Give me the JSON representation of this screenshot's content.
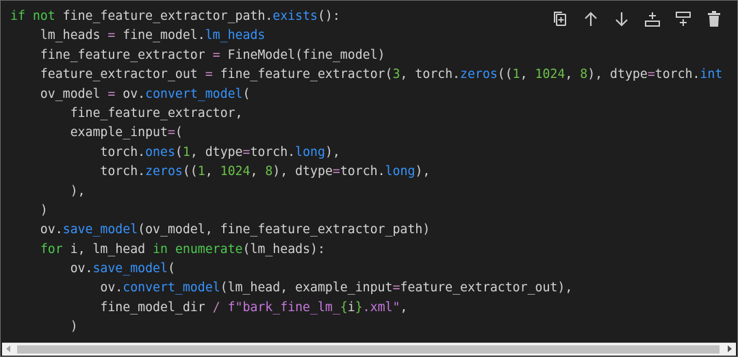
{
  "toolbar": {
    "icons": [
      "copy-icon",
      "arrow-up-icon",
      "arrow-down-icon",
      "insert-above-icon",
      "insert-below-icon",
      "trash-icon"
    ]
  },
  "code": {
    "language": "python",
    "lines": [
      [
        [
          "kw",
          "if"
        ],
        [
          "p",
          " "
        ],
        [
          "kw",
          "not"
        ],
        [
          "p",
          " fine_feature_extractor_path."
        ],
        [
          "fn",
          "exists"
        ],
        [
          "p",
          "():"
        ]
      ],
      [
        [
          "p",
          "    lm_heads "
        ],
        [
          "op",
          "="
        ],
        [
          "p",
          " fine_model."
        ],
        [
          "fn",
          "lm_heads"
        ]
      ],
      [
        [
          "p",
          "    fine_feature_extractor "
        ],
        [
          "op",
          "="
        ],
        [
          "p",
          " FineModel(fine_model)"
        ]
      ],
      [
        [
          "p",
          "    feature_extractor_out "
        ],
        [
          "op",
          "="
        ],
        [
          "p",
          " fine_feature_extractor("
        ],
        [
          "num",
          "3"
        ],
        [
          "p",
          ", torch."
        ],
        [
          "fn",
          "zeros"
        ],
        [
          "p",
          "(("
        ],
        [
          "num",
          "1"
        ],
        [
          "p",
          ", "
        ],
        [
          "num",
          "1024"
        ],
        [
          "p",
          ", "
        ],
        [
          "num",
          "8"
        ],
        [
          "p",
          "), dtype"
        ],
        [
          "op",
          "="
        ],
        [
          "p",
          "torch."
        ],
        [
          "fn",
          "int"
        ]
      ],
      [
        [
          "p",
          "    ov_model "
        ],
        [
          "op",
          "="
        ],
        [
          "p",
          " ov."
        ],
        [
          "fn",
          "convert_model"
        ],
        [
          "p",
          "("
        ]
      ],
      [
        [
          "p",
          "        fine_feature_extractor,"
        ]
      ],
      [
        [
          "p",
          "        example_input"
        ],
        [
          "op",
          "="
        ],
        [
          "p",
          "("
        ]
      ],
      [
        [
          "p",
          "            torch."
        ],
        [
          "fn",
          "ones"
        ],
        [
          "p",
          "("
        ],
        [
          "num",
          "1"
        ],
        [
          "p",
          ", dtype"
        ],
        [
          "op",
          "="
        ],
        [
          "p",
          "torch."
        ],
        [
          "fn",
          "long"
        ],
        [
          "p",
          "),"
        ]
      ],
      [
        [
          "p",
          "            torch."
        ],
        [
          "fn",
          "zeros"
        ],
        [
          "p",
          "(("
        ],
        [
          "num",
          "1"
        ],
        [
          "p",
          ", "
        ],
        [
          "num",
          "1024"
        ],
        [
          "p",
          ", "
        ],
        [
          "num",
          "8"
        ],
        [
          "p",
          "), dtype"
        ],
        [
          "op",
          "="
        ],
        [
          "p",
          "torch."
        ],
        [
          "fn",
          "long"
        ],
        [
          "p",
          "),"
        ]
      ],
      [
        [
          "p",
          "        ),"
        ]
      ],
      [
        [
          "p",
          "    )"
        ]
      ],
      [
        [
          "p",
          "    ov."
        ],
        [
          "fn",
          "save_model"
        ],
        [
          "p",
          "(ov_model, fine_feature_extractor_path)"
        ]
      ],
      [
        [
          "p",
          "    "
        ],
        [
          "kw",
          "for"
        ],
        [
          "p",
          " i, lm_head "
        ],
        [
          "kw",
          "in"
        ],
        [
          "p",
          " "
        ],
        [
          "builtin",
          "enumerate"
        ],
        [
          "p",
          "(lm_heads):"
        ]
      ],
      [
        [
          "p",
          "        ov."
        ],
        [
          "fn",
          "save_model"
        ],
        [
          "p",
          "("
        ]
      ],
      [
        [
          "p",
          "            ov."
        ],
        [
          "fn",
          "convert_model"
        ],
        [
          "p",
          "(lm_head, example_input"
        ],
        [
          "op",
          "="
        ],
        [
          "p",
          "feature_extractor_out),"
        ]
      ],
      [
        [
          "p",
          "            fine_model_dir "
        ],
        [
          "op",
          "/"
        ],
        [
          "p",
          " "
        ],
        [
          "fstr",
          "f\"bark_fine_lm_"
        ],
        [
          "num",
          "{"
        ],
        [
          "p",
          "i"
        ],
        [
          "num",
          "}"
        ],
        [
          "fstr",
          ".xml\""
        ],
        [
          "p",
          ","
        ]
      ],
      [
        [
          "p",
          "        )"
        ]
      ]
    ]
  },
  "colors": {
    "background": "#1e1e1e",
    "keyword": "#4ec94e",
    "function": "#3794ff",
    "number": "#6cc24a",
    "operator": "#c586c0",
    "fstring": "#c678dd",
    "text": "#d4d4d4"
  }
}
